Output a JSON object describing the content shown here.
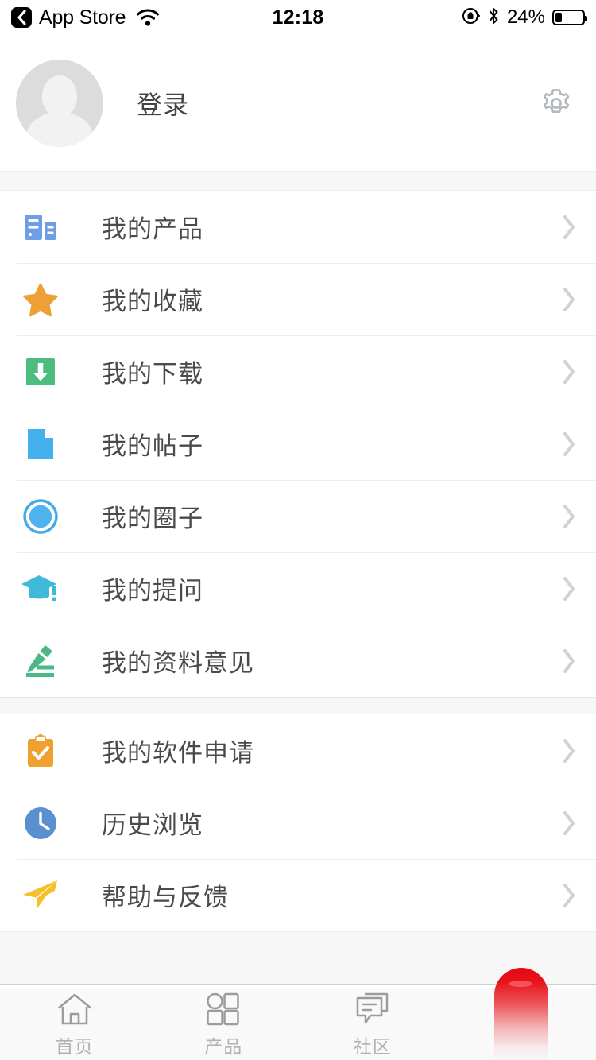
{
  "status_bar": {
    "back_icon": "back-chevron-icon",
    "back_app": "App Store",
    "wifi_icon": "wifi-icon",
    "time": "12:18",
    "rotation_lock_icon": "rotation-lock-icon",
    "bluetooth_icon": "bluetooth-icon",
    "battery_percent": "24%",
    "battery_level": 24
  },
  "profile": {
    "avatar_icon": "default-avatar-icon",
    "login_label": "登录",
    "settings_icon": "gear-icon"
  },
  "groups": [
    {
      "items": [
        {
          "icon": "server-icon",
          "label": "我的产品",
          "color": "#6f9ee8"
        },
        {
          "icon": "star-icon",
          "label": "我的收藏",
          "color": "#eda036"
        },
        {
          "icon": "download-icon",
          "label": "我的下载",
          "color": "#4cbd7e"
        },
        {
          "icon": "document-icon",
          "label": "我的帖子",
          "color": "#44b0ee"
        },
        {
          "icon": "circle-ring-icon",
          "label": "我的圈子",
          "color": "#44a8e8"
        },
        {
          "icon": "graduation-cap-icon",
          "label": "我的提问",
          "color": "#3fb9d8"
        },
        {
          "icon": "pen-edit-icon",
          "label": "我的资料意见",
          "color": "#4cb984"
        }
      ]
    },
    {
      "items": [
        {
          "icon": "clipboard-check-icon",
          "label": "我的软件申请",
          "color": "#f0a02e"
        },
        {
          "icon": "clock-icon",
          "label": "历史浏览",
          "color": "#5a8fd0"
        },
        {
          "icon": "paper-plane-icon",
          "label": "帮助与反馈",
          "color": "#f5c02a"
        }
      ]
    }
  ],
  "row_chevron_icon": "chevron-right-icon",
  "tabbar": {
    "tabs": [
      {
        "icon": "home-icon",
        "label": "首页"
      },
      {
        "icon": "grid-icon",
        "label": "产品"
      },
      {
        "icon": "comment-icon",
        "label": "社区"
      },
      {
        "icon": "profile-icon",
        "label": ""
      }
    ],
    "touch_indicator_color": "#e50914"
  }
}
